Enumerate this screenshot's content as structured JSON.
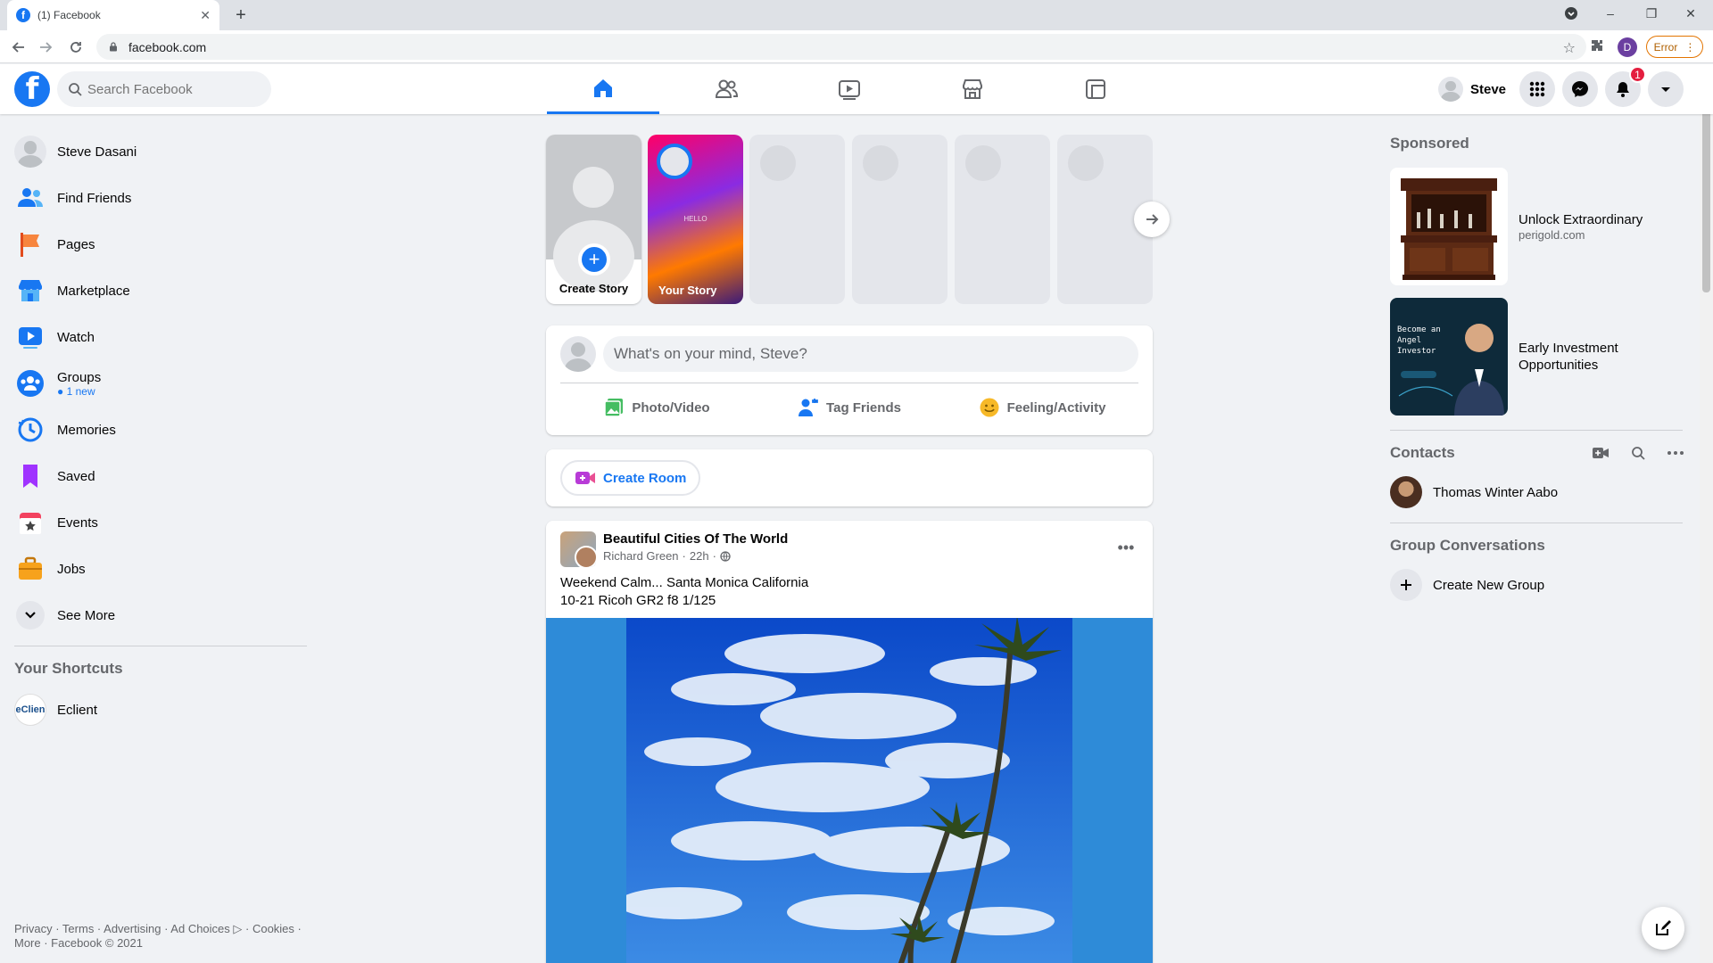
{
  "browser": {
    "tab_title": "(1) Facebook",
    "tab_close": "✕",
    "new_tab": "+",
    "url": "facebook.com",
    "profile_initial": "D",
    "error_label": "Error",
    "controls": {
      "minimize": "–",
      "restore": "❐",
      "close": "✕"
    }
  },
  "header": {
    "logo": "f",
    "search_placeholder": "Search Facebook",
    "nav_tabs": [
      {
        "name": "home-icon",
        "active": true
      },
      {
        "name": "friends-icon",
        "active": false
      },
      {
        "name": "watch-icon",
        "active": false
      },
      {
        "name": "marketplace-icon",
        "active": false
      },
      {
        "name": "gaming-icon",
        "active": false
      }
    ],
    "user_name": "Steve",
    "notification_count": "1"
  },
  "left_nav": {
    "items": [
      {
        "label": "Steve Dasani",
        "icon": "profile-avatar"
      },
      {
        "label": "Find Friends",
        "icon": "friends-icon"
      },
      {
        "label": "Pages",
        "icon": "flag-icon"
      },
      {
        "label": "Marketplace",
        "icon": "shop-icon"
      },
      {
        "label": "Watch",
        "icon": "play-icon"
      },
      {
        "label": "Groups",
        "icon": "groups-icon",
        "sub": "1 new"
      },
      {
        "label": "Memories",
        "icon": "clock-icon"
      },
      {
        "label": "Saved",
        "icon": "bookmark-icon"
      },
      {
        "label": "Events",
        "icon": "calendar-icon"
      },
      {
        "label": "Jobs",
        "icon": "briefcase-icon"
      },
      {
        "label": "See More",
        "icon": "chevron-down-icon"
      }
    ],
    "shortcuts_title": "Your Shortcuts",
    "shortcut": {
      "label": "Eclient",
      "icon_text": "eClien"
    },
    "footer_line1": "Privacy · Terms · Advertising · Ad Choices ▷ · Cookies ·",
    "footer_line2": "More · Facebook © 2021"
  },
  "stories": {
    "create_label": "Create Story",
    "your_story_label": "Your Story",
    "your_story_text": "HELLO"
  },
  "composer": {
    "placeholder": "What's on your mind, Steve?",
    "actions": [
      "Photo/Video",
      "Tag Friends",
      "Feeling/Activity"
    ]
  },
  "room": {
    "label": "Create Room"
  },
  "post": {
    "page_name": "Beautiful Cities Of The World",
    "author": "Richard Green",
    "time": "22h",
    "line1": "Weekend Calm... Santa Monica California",
    "line2": "10-21  Ricoh GR2 f8 1/125",
    "more": "•••"
  },
  "right": {
    "sponsored_title": "Sponsored",
    "ads": [
      {
        "title": "Unlock Extraordinary",
        "domain": "perigold.com"
      },
      {
        "title": "Early Investment Opportunities",
        "domain": ""
      }
    ],
    "ad2_text": "Become an Angel Investor",
    "contacts_title": "Contacts",
    "contacts": [
      {
        "name": "Thomas Winter Aabo"
      }
    ],
    "groups_title": "Group Conversations",
    "create_group": "Create New Group"
  },
  "colors": {
    "brand": "#1877f2",
    "badge": "#e41e3f"
  }
}
